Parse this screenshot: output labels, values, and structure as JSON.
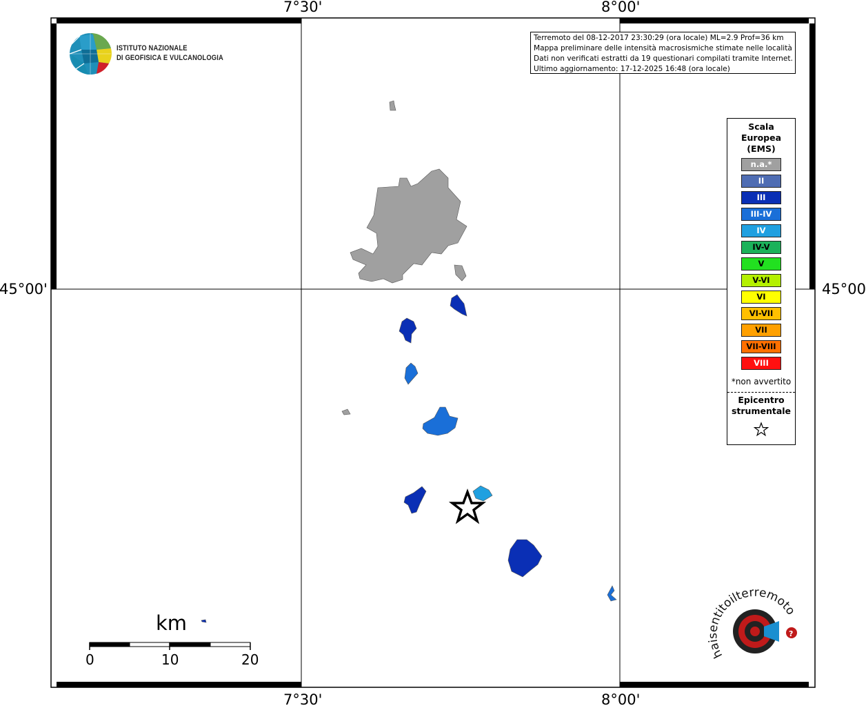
{
  "map": {
    "coords": {
      "top": [
        "7°30'",
        "8°00'"
      ],
      "bottom": [
        "7°30'",
        "8°00'"
      ],
      "left": "45°00'",
      "right": "45°00'"
    },
    "info_lines": [
      "Terremoto del 08-12-2017 23:30:29 (ora locale) ML=2.9 Prof=36 km",
      "Mappa preliminare delle intensità macrosismiche stimate nelle località",
      "Dati non verificati estratti da 19 questionari compilati tramite Internet.",
      "Ultimo aggiornamento: 17-12-2025 16:48 (ora locale)"
    ],
    "logo": {
      "line1": "ISTITUTO NAZIONALE",
      "line2": "DI GEOFISICA E VULCANOLOGIA"
    },
    "scalebar": {
      "unit": "km",
      "ticks": [
        "0",
        "10",
        "20"
      ]
    },
    "watermark_text": "haisentitoilterremoto.it www."
  },
  "legend": {
    "title": "Scala Europea (EMS)",
    "title_lines": [
      "Scala",
      "Europea",
      "(EMS)"
    ],
    "classes": [
      {
        "label": "n.a.*",
        "color": "#a0a0a0",
        "text_color": "#ffffff"
      },
      {
        "label": "II",
        "color": "#4f6db3",
        "text_color": "#ffffff"
      },
      {
        "label": "III",
        "color": "#0a2fb5",
        "text_color": "#ffffff"
      },
      {
        "label": "III-IV",
        "color": "#1a6fd8",
        "text_color": "#ffffff"
      },
      {
        "label": "IV",
        "color": "#20a0e0",
        "text_color": "#ffffff"
      },
      {
        "label": "IV-V",
        "color": "#1bb25a",
        "text_color": "#000000"
      },
      {
        "label": "V",
        "color": "#22e020",
        "text_color": "#000000"
      },
      {
        "label": "V-VI",
        "color": "#b4f000",
        "text_color": "#000000"
      },
      {
        "label": "VI",
        "color": "#ffff00",
        "text_color": "#000000"
      },
      {
        "label": "VI-VII",
        "color": "#ffc000",
        "text_color": "#000000"
      },
      {
        "label": "VII",
        "color": "#ffa000",
        "text_color": "#000000"
      },
      {
        "label": "VII-VIII",
        "color": "#ff7000",
        "text_color": "#000000"
      },
      {
        "label": "VIII",
        "color": "#ff1010",
        "text_color": "#ffffff"
      }
    ],
    "note": "*non avvertito",
    "epicenter_label": "Epicentro strumentale",
    "epicenter_lines": [
      "Epicentro",
      "strumentale"
    ]
  },
  "localities": [
    {
      "intensity": "n.a.",
      "color": "#a0a0a0"
    },
    {
      "intensity": "III",
      "color": "#0a2fb5"
    },
    {
      "intensity": "III-IV",
      "color": "#1a6fd8"
    },
    {
      "intensity": "IV",
      "color": "#20a0e0"
    }
  ]
}
